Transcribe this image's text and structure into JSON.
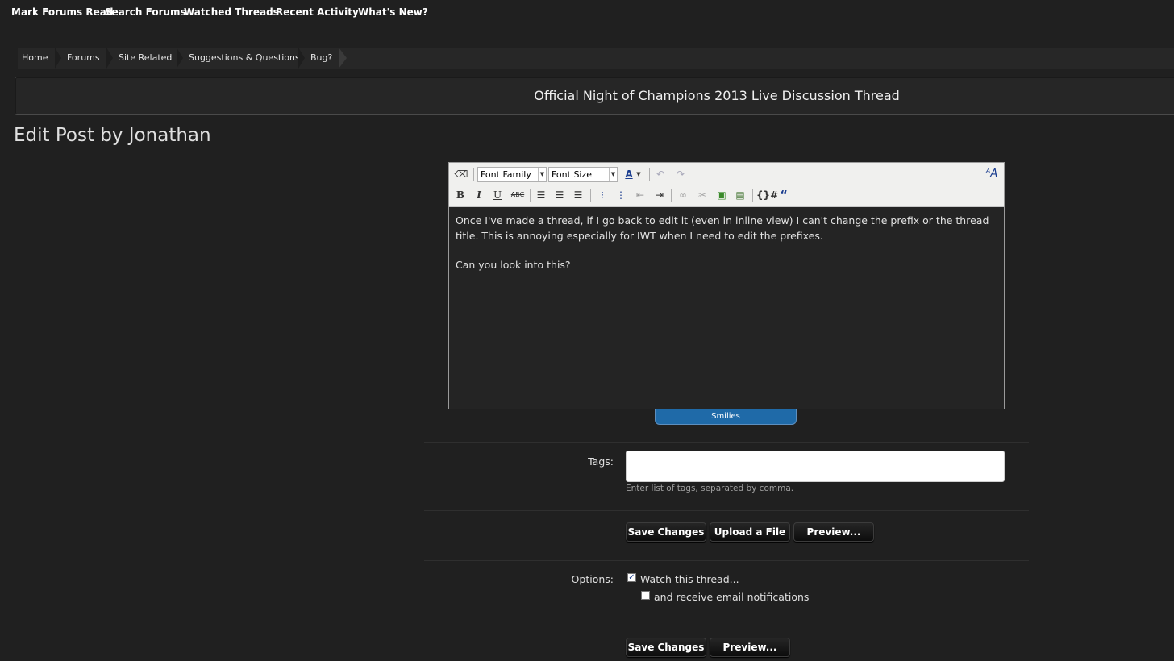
{
  "topnav": {
    "items": [
      "Mark Forums Read",
      "Search Forums",
      "Watched Threads",
      "Recent Activity",
      "What's New?"
    ]
  },
  "breadcrumbs": [
    "Home",
    "Forums",
    "Site Related",
    "Suggestions & Questions",
    "Bug?"
  ],
  "thread_title": "Official Night of Champions 2013 Live Discussion Thread",
  "page_title": "Edit Post by Jonathan",
  "editor": {
    "font_family_label": "Font Family",
    "font_size_label": "Font Size",
    "body_lines": [
      "Once I've made a thread, if I go back to edit it (even in inline view) I can't change the prefix or the thread title. This is annoying especially for IWT when I need to edit the prefixes.",
      "Can you look into this?"
    ],
    "smilies_label": "Smilies"
  },
  "tags": {
    "label": "Tags:",
    "value": "",
    "hint": "Enter list of tags, separated by comma."
  },
  "buttons": {
    "save_changes": "Save Changes",
    "upload_file": "Upload a File",
    "preview": "Preview..."
  },
  "options": {
    "label": "Options:",
    "watch_thread": "Watch this thread...",
    "watch_checked": true,
    "email_notify": "and receive email notifications",
    "email_checked": false
  },
  "colors": {
    "background": "#202020",
    "smilies_tab": "#1f6aa8"
  }
}
